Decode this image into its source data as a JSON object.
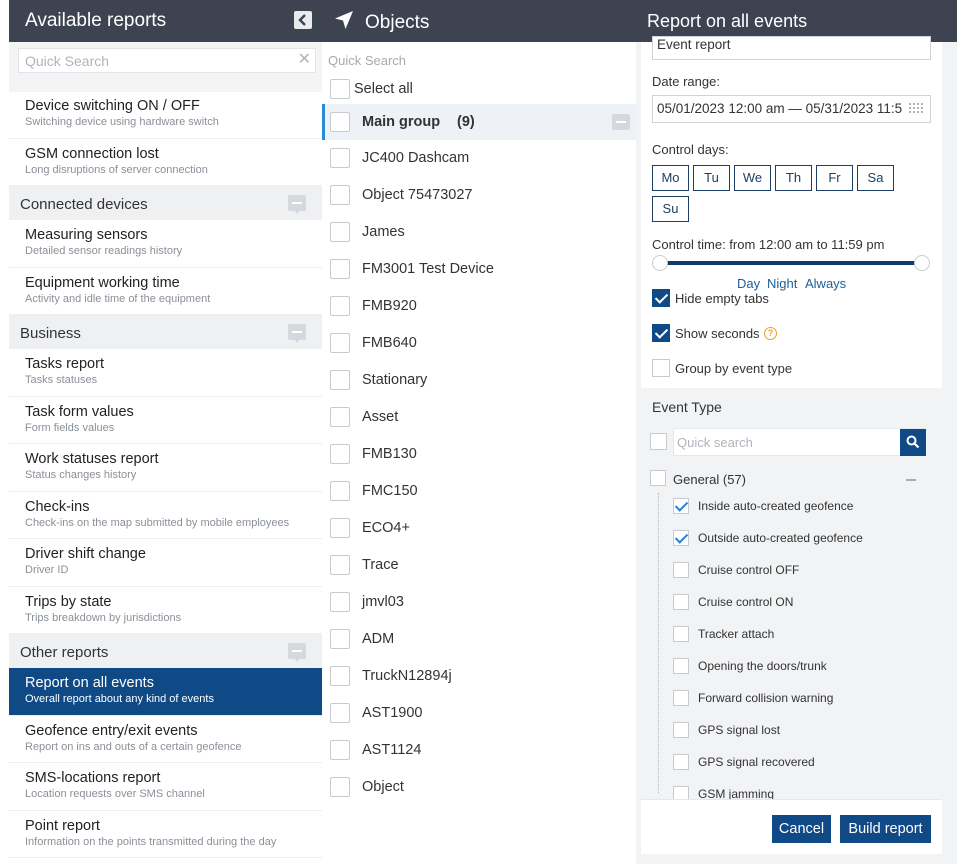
{
  "header": {
    "available_reports": "Available reports",
    "objects": "Objects",
    "report_title": "Report on all events",
    "icons": {
      "collapse": "chevron-left-icon",
      "nav": "navigation-arrow-icon"
    }
  },
  "left": {
    "search_placeholder": "Quick Search",
    "top_items": [
      {
        "name": "Device switching ON / OFF",
        "desc": "Switching device using hardware switch"
      },
      {
        "name": "GSM connection lost",
        "desc": "Long disruptions of server connection"
      }
    ],
    "categories": [
      {
        "title": "Connected devices",
        "items": [
          {
            "name": "Measuring sensors",
            "desc": "Detailed sensor readings history"
          },
          {
            "name": "Equipment working time",
            "desc": "Activity and idle time of the equipment"
          }
        ]
      },
      {
        "title": "Business",
        "items": [
          {
            "name": "Tasks report",
            "desc": "Tasks statuses"
          },
          {
            "name": "Task form values",
            "desc": "Form fields values"
          },
          {
            "name": "Work statuses report",
            "desc": "Status changes history"
          },
          {
            "name": "Check-ins",
            "desc": "Check-ins on the map submitted by mobile employees"
          },
          {
            "name": "Driver shift change",
            "desc": "Driver ID"
          },
          {
            "name": "Trips by state",
            "desc": "Trips breakdown by jurisdictions"
          }
        ]
      },
      {
        "title": "Other reports",
        "items": [
          {
            "name": "Report on all events",
            "desc": "Overall report about any kind of events"
          },
          {
            "name": "Geofence entry/exit events",
            "desc": "Report on ins and outs of a certain geofence"
          },
          {
            "name": "SMS-locations report",
            "desc": "Location requests over SMS channel"
          },
          {
            "name": "Point report",
            "desc": "Information on the points transmitted during the day"
          }
        ]
      }
    ]
  },
  "objects": {
    "search_placeholder": "Quick Search",
    "select_all": "Select all",
    "group_name": "Main group",
    "group_count": "(9)",
    "items": [
      "JC400 Dashcam",
      "Object 75473027",
      "James",
      "FM3001 Test Device",
      "FMB920",
      "FMB640",
      "Stationary",
      "Asset",
      "FMB130",
      "FMC150",
      "ECO4+",
      "Trace",
      "jmvl03",
      "ADM",
      "TruckN12894j",
      "AST1900",
      "AST1124",
      "Object"
    ]
  },
  "report": {
    "report_type": "Event report",
    "date_range_label": "Date range:",
    "date_range_value": "05/01/2023 12:00 am — 05/31/2023 11:5",
    "control_days_label": "Control days:",
    "days": [
      "Mo",
      "Tu",
      "We",
      "Th",
      "Fr",
      "Sa",
      "Su"
    ],
    "control_time_label": "Control time: from 12:00 am to 11:59 pm",
    "time_options": [
      "Day",
      "Night",
      "Always"
    ],
    "hide_empty_tabs": "Hide empty tabs",
    "show_seconds": "Show seconds",
    "group_by_event_type": "Group by event type",
    "help_glyph": "?",
    "event_type_title": "Event Type",
    "event_search_placeholder": "Quick search",
    "general_label": "General (57)",
    "events": [
      {
        "label": "Inside auto-created geofence",
        "checked": true
      },
      {
        "label": "Outside auto-created geofence",
        "checked": true
      },
      {
        "label": "Cruise control OFF",
        "checked": false
      },
      {
        "label": "Cruise control ON",
        "checked": false
      },
      {
        "label": "Tracker attach",
        "checked": false
      },
      {
        "label": "Opening the doors/trunk",
        "checked": false
      },
      {
        "label": "Forward collision warning",
        "checked": false
      },
      {
        "label": "GPS signal lost",
        "checked": false
      },
      {
        "label": "GPS signal recovered",
        "checked": false
      },
      {
        "label": "GSM jamming",
        "checked": false
      }
    ],
    "cancel": "Cancel",
    "build": "Build report"
  }
}
